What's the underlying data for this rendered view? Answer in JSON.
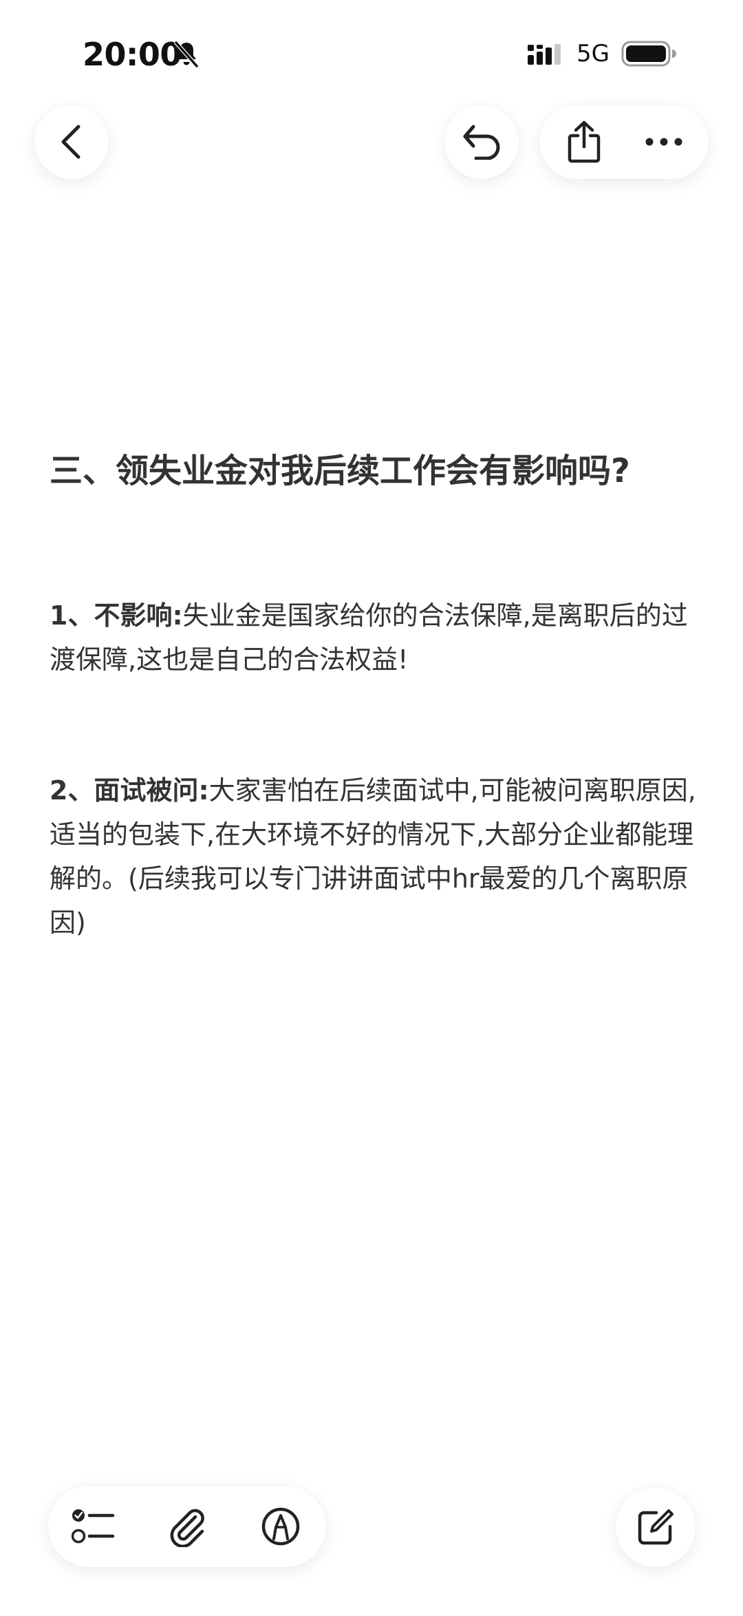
{
  "status_bar": {
    "time": "20:00",
    "network": "5G",
    "icons": [
      "bell-muted-icon",
      "signal-icon",
      "battery-icon"
    ]
  },
  "toolbar": {
    "icons": [
      "back-icon",
      "undo-icon",
      "share-icon",
      "more-icon"
    ]
  },
  "note": {
    "title": "三、领失业金对我后续工作会有影响吗?",
    "paragraphs": [
      {
        "lead": "1、不影响:",
        "text": "失业金是国家给你的合法保障,是离职后的过渡保障,这也是自己的合法权益!"
      },
      {
        "lead": "2、面试被问:",
        "text": "大家害怕在后续面试中,可能被问离职原因,适当的包装下,在大环境不好的情况下,大部分企业都能理解的。(后续我可以专门讲讲面试中hr最爱的几个离职原因)"
      }
    ]
  },
  "bottom_bar": {
    "icons": [
      "checklist-icon",
      "attachment-icon",
      "markup-icon",
      "compose-icon"
    ]
  },
  "colors": {
    "text": "#333333",
    "background": "#ffffff"
  }
}
